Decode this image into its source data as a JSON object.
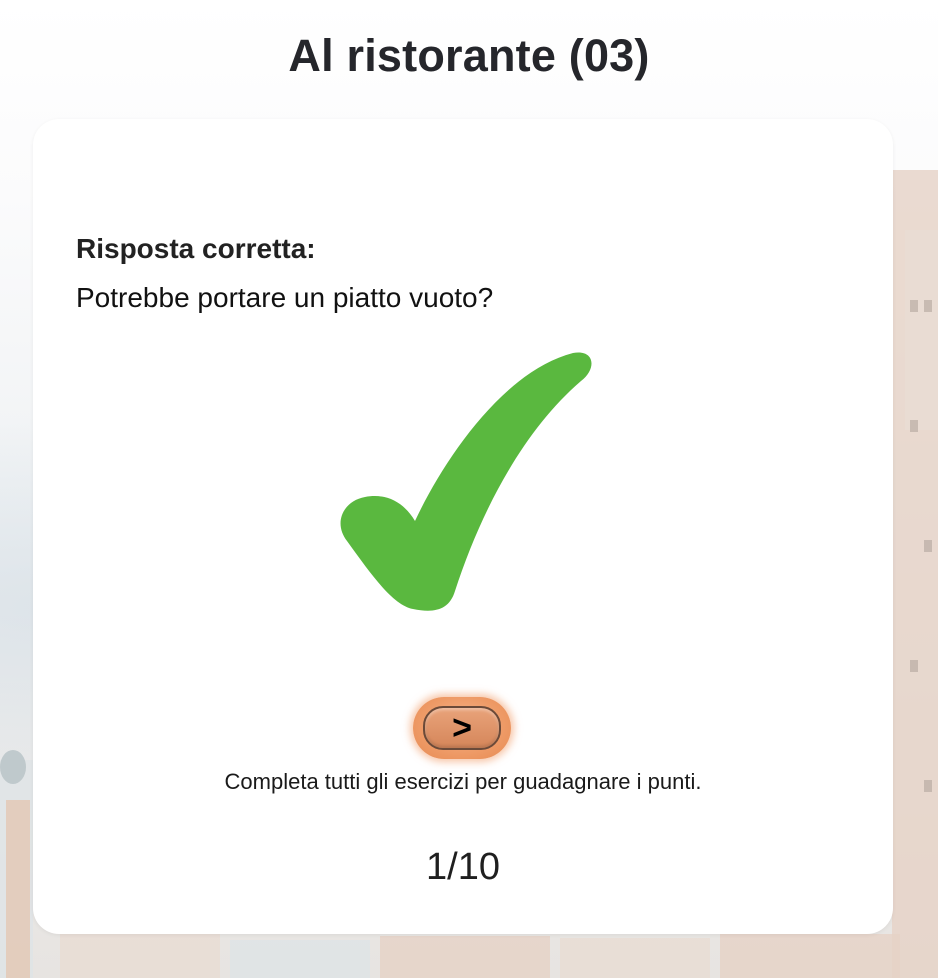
{
  "page": {
    "title": "Al ristorante (03)"
  },
  "feedback": {
    "heading": "Risposta corretta:",
    "answer": "Potrebbe portare un piatto vuoto?",
    "icon": "checkmark-icon",
    "icon_color": "#5ab83f"
  },
  "controls": {
    "next_label": ">",
    "next_color": "#ee9a66"
  },
  "hint": {
    "text": "Completa tutti gli esercizi per guadagnare i punti."
  },
  "progress": {
    "text": "1/10",
    "current": 1,
    "total": 10
  },
  "background": {
    "image": "faded-coastal-town"
  }
}
